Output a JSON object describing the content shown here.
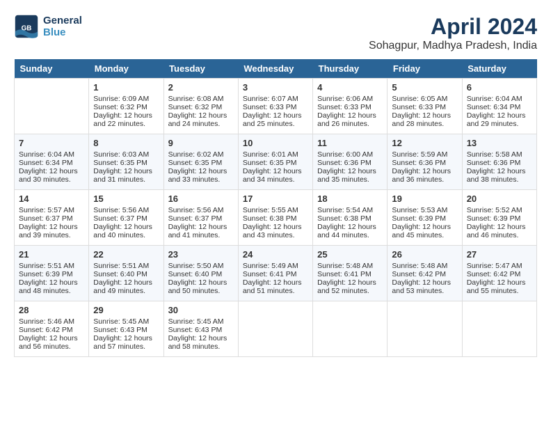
{
  "header": {
    "logo_line1": "General",
    "logo_line2": "Blue",
    "month_year": "April 2024",
    "location": "Sohagpur, Madhya Pradesh, India"
  },
  "weekdays": [
    "Sunday",
    "Monday",
    "Tuesday",
    "Wednesday",
    "Thursday",
    "Friday",
    "Saturday"
  ],
  "weeks": [
    [
      {
        "day": "",
        "empty": true
      },
      {
        "day": "1",
        "sunrise": "Sunrise: 6:09 AM",
        "sunset": "Sunset: 6:32 PM",
        "daylight": "Daylight: 12 hours and 22 minutes."
      },
      {
        "day": "2",
        "sunrise": "Sunrise: 6:08 AM",
        "sunset": "Sunset: 6:32 PM",
        "daylight": "Daylight: 12 hours and 24 minutes."
      },
      {
        "day": "3",
        "sunrise": "Sunrise: 6:07 AM",
        "sunset": "Sunset: 6:33 PM",
        "daylight": "Daylight: 12 hours and 25 minutes."
      },
      {
        "day": "4",
        "sunrise": "Sunrise: 6:06 AM",
        "sunset": "Sunset: 6:33 PM",
        "daylight": "Daylight: 12 hours and 26 minutes."
      },
      {
        "day": "5",
        "sunrise": "Sunrise: 6:05 AM",
        "sunset": "Sunset: 6:33 PM",
        "daylight": "Daylight: 12 hours and 28 minutes."
      },
      {
        "day": "6",
        "sunrise": "Sunrise: 6:04 AM",
        "sunset": "Sunset: 6:34 PM",
        "daylight": "Daylight: 12 hours and 29 minutes."
      }
    ],
    [
      {
        "day": "7",
        "sunrise": "Sunrise: 6:04 AM",
        "sunset": "Sunset: 6:34 PM",
        "daylight": "Daylight: 12 hours and 30 minutes."
      },
      {
        "day": "8",
        "sunrise": "Sunrise: 6:03 AM",
        "sunset": "Sunset: 6:35 PM",
        "daylight": "Daylight: 12 hours and 31 minutes."
      },
      {
        "day": "9",
        "sunrise": "Sunrise: 6:02 AM",
        "sunset": "Sunset: 6:35 PM",
        "daylight": "Daylight: 12 hours and 33 minutes."
      },
      {
        "day": "10",
        "sunrise": "Sunrise: 6:01 AM",
        "sunset": "Sunset: 6:35 PM",
        "daylight": "Daylight: 12 hours and 34 minutes."
      },
      {
        "day": "11",
        "sunrise": "Sunrise: 6:00 AM",
        "sunset": "Sunset: 6:36 PM",
        "daylight": "Daylight: 12 hours and 35 minutes."
      },
      {
        "day": "12",
        "sunrise": "Sunrise: 5:59 AM",
        "sunset": "Sunset: 6:36 PM",
        "daylight": "Daylight: 12 hours and 36 minutes."
      },
      {
        "day": "13",
        "sunrise": "Sunrise: 5:58 AM",
        "sunset": "Sunset: 6:36 PM",
        "daylight": "Daylight: 12 hours and 38 minutes."
      }
    ],
    [
      {
        "day": "14",
        "sunrise": "Sunrise: 5:57 AM",
        "sunset": "Sunset: 6:37 PM",
        "daylight": "Daylight: 12 hours and 39 minutes."
      },
      {
        "day": "15",
        "sunrise": "Sunrise: 5:56 AM",
        "sunset": "Sunset: 6:37 PM",
        "daylight": "Daylight: 12 hours and 40 minutes."
      },
      {
        "day": "16",
        "sunrise": "Sunrise: 5:56 AM",
        "sunset": "Sunset: 6:37 PM",
        "daylight": "Daylight: 12 hours and 41 minutes."
      },
      {
        "day": "17",
        "sunrise": "Sunrise: 5:55 AM",
        "sunset": "Sunset: 6:38 PM",
        "daylight": "Daylight: 12 hours and 43 minutes."
      },
      {
        "day": "18",
        "sunrise": "Sunrise: 5:54 AM",
        "sunset": "Sunset: 6:38 PM",
        "daylight": "Daylight: 12 hours and 44 minutes."
      },
      {
        "day": "19",
        "sunrise": "Sunrise: 5:53 AM",
        "sunset": "Sunset: 6:39 PM",
        "daylight": "Daylight: 12 hours and 45 minutes."
      },
      {
        "day": "20",
        "sunrise": "Sunrise: 5:52 AM",
        "sunset": "Sunset: 6:39 PM",
        "daylight": "Daylight: 12 hours and 46 minutes."
      }
    ],
    [
      {
        "day": "21",
        "sunrise": "Sunrise: 5:51 AM",
        "sunset": "Sunset: 6:39 PM",
        "daylight": "Daylight: 12 hours and 48 minutes."
      },
      {
        "day": "22",
        "sunrise": "Sunrise: 5:51 AM",
        "sunset": "Sunset: 6:40 PM",
        "daylight": "Daylight: 12 hours and 49 minutes."
      },
      {
        "day": "23",
        "sunrise": "Sunrise: 5:50 AM",
        "sunset": "Sunset: 6:40 PM",
        "daylight": "Daylight: 12 hours and 50 minutes."
      },
      {
        "day": "24",
        "sunrise": "Sunrise: 5:49 AM",
        "sunset": "Sunset: 6:41 PM",
        "daylight": "Daylight: 12 hours and 51 minutes."
      },
      {
        "day": "25",
        "sunrise": "Sunrise: 5:48 AM",
        "sunset": "Sunset: 6:41 PM",
        "daylight": "Daylight: 12 hours and 52 minutes."
      },
      {
        "day": "26",
        "sunrise": "Sunrise: 5:48 AM",
        "sunset": "Sunset: 6:42 PM",
        "daylight": "Daylight: 12 hours and 53 minutes."
      },
      {
        "day": "27",
        "sunrise": "Sunrise: 5:47 AM",
        "sunset": "Sunset: 6:42 PM",
        "daylight": "Daylight: 12 hours and 55 minutes."
      }
    ],
    [
      {
        "day": "28",
        "sunrise": "Sunrise: 5:46 AM",
        "sunset": "Sunset: 6:42 PM",
        "daylight": "Daylight: 12 hours and 56 minutes."
      },
      {
        "day": "29",
        "sunrise": "Sunrise: 5:45 AM",
        "sunset": "Sunset: 6:43 PM",
        "daylight": "Daylight: 12 hours and 57 minutes."
      },
      {
        "day": "30",
        "sunrise": "Sunrise: 5:45 AM",
        "sunset": "Sunset: 6:43 PM",
        "daylight": "Daylight: 12 hours and 58 minutes."
      },
      {
        "day": "",
        "empty": true
      },
      {
        "day": "",
        "empty": true
      },
      {
        "day": "",
        "empty": true
      },
      {
        "day": "",
        "empty": true
      }
    ]
  ]
}
